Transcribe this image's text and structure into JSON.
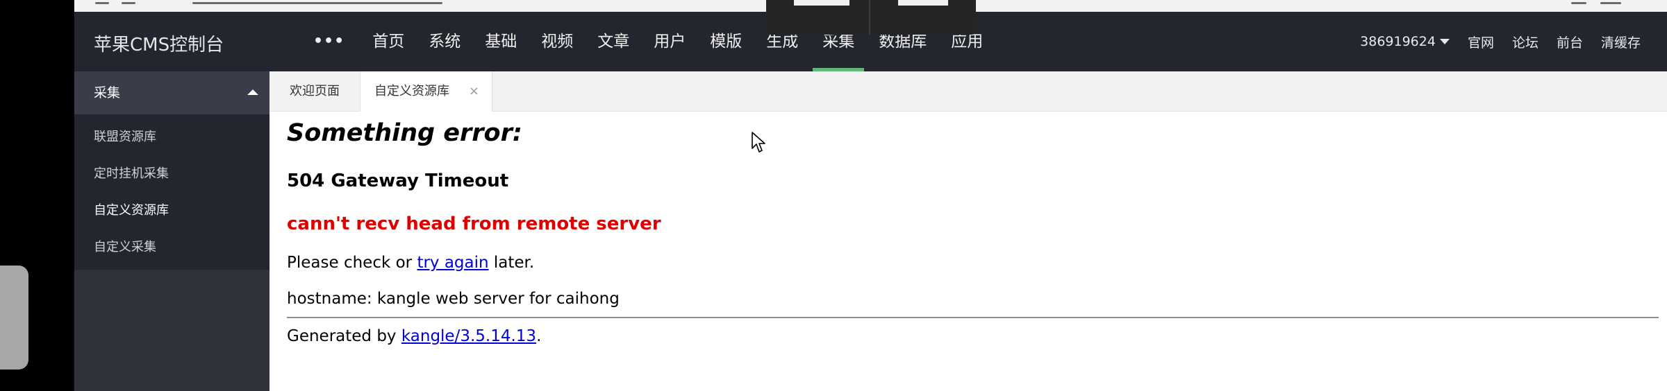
{
  "header": {
    "brand": "苹果CMS控制台",
    "nav": [
      {
        "label": "•••",
        "active": false
      },
      {
        "label": "首页",
        "active": false
      },
      {
        "label": "系统",
        "active": false
      },
      {
        "label": "基础",
        "active": false
      },
      {
        "label": "视频",
        "active": false
      },
      {
        "label": "文章",
        "active": false
      },
      {
        "label": "用户",
        "active": false
      },
      {
        "label": "模版",
        "active": false
      },
      {
        "label": "生成",
        "active": false
      },
      {
        "label": "采集",
        "active": true
      },
      {
        "label": "数据库",
        "active": false
      },
      {
        "label": "应用",
        "active": false
      }
    ],
    "user": "386919624",
    "links": [
      "官网",
      "论坛",
      "前台",
      "清缓存"
    ]
  },
  "sidebar": {
    "title": "采集",
    "items": [
      "联盟资源库",
      "定时挂机采集",
      "自定义资源库",
      "自定义采集"
    ],
    "current_index": 2
  },
  "tabs": [
    {
      "label": "欢迎页面"
    },
    {
      "label": "自定义资源库",
      "close": "×"
    }
  ],
  "error_page": {
    "title": "Something error:",
    "code": "504 Gateway Timeout",
    "reason": "cann't recv head from remote server",
    "hint_prefix": "Please check or ",
    "hint_link": "try again",
    "hint_suffix": " later.",
    "hostname": "hostname: kangle web server for caihong",
    "generated_prefix": "Generated by ",
    "generated_link": "kangle/3.5.14.13",
    "generated_suffix": "."
  },
  "colors": {
    "header_bg": "#23262e",
    "sidebar_bg": "#2f323b",
    "accent": "#5fb878",
    "error_red": "#e00000"
  }
}
